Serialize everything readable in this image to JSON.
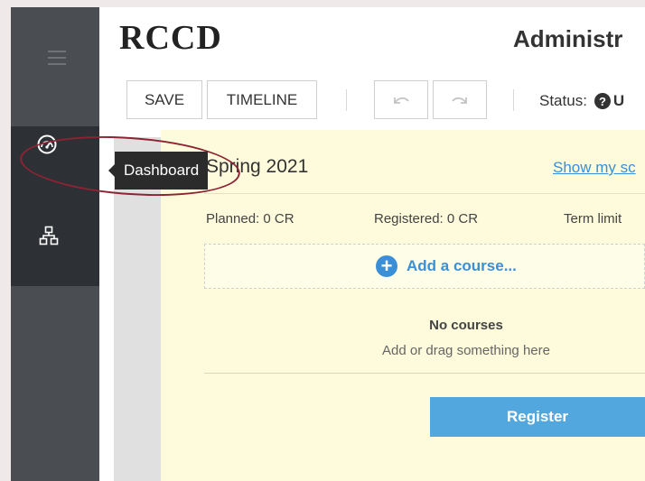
{
  "app": {
    "logo": "RCCD",
    "title": "Administr"
  },
  "sidebar": {
    "items": [
      {
        "icon": "dashboard-gauge-icon",
        "tooltip": "Dashboard"
      },
      {
        "icon": "sitemap-icon"
      }
    ]
  },
  "toolbar": {
    "save_label": "SAVE",
    "timeline_label": "TIMELINE",
    "status_label": "Status:",
    "status_value": "U"
  },
  "term": {
    "title": "Spring 2021",
    "show_link": "Show my sc",
    "planned": "Planned: 0 CR",
    "registered": "Registered: 0 CR",
    "term_limit": "Term limit",
    "add_course": "Add a course...",
    "empty_title": "No courses",
    "empty_sub": "Add or drag something here",
    "register_label": "Register"
  },
  "colors": {
    "sidebar": "#4a4d52",
    "sidebar_active": "#2d3035",
    "term_bg": "#fdfbdb",
    "accent": "#3a8fd6",
    "register": "#52a8de",
    "highlight": "#8d2333"
  }
}
